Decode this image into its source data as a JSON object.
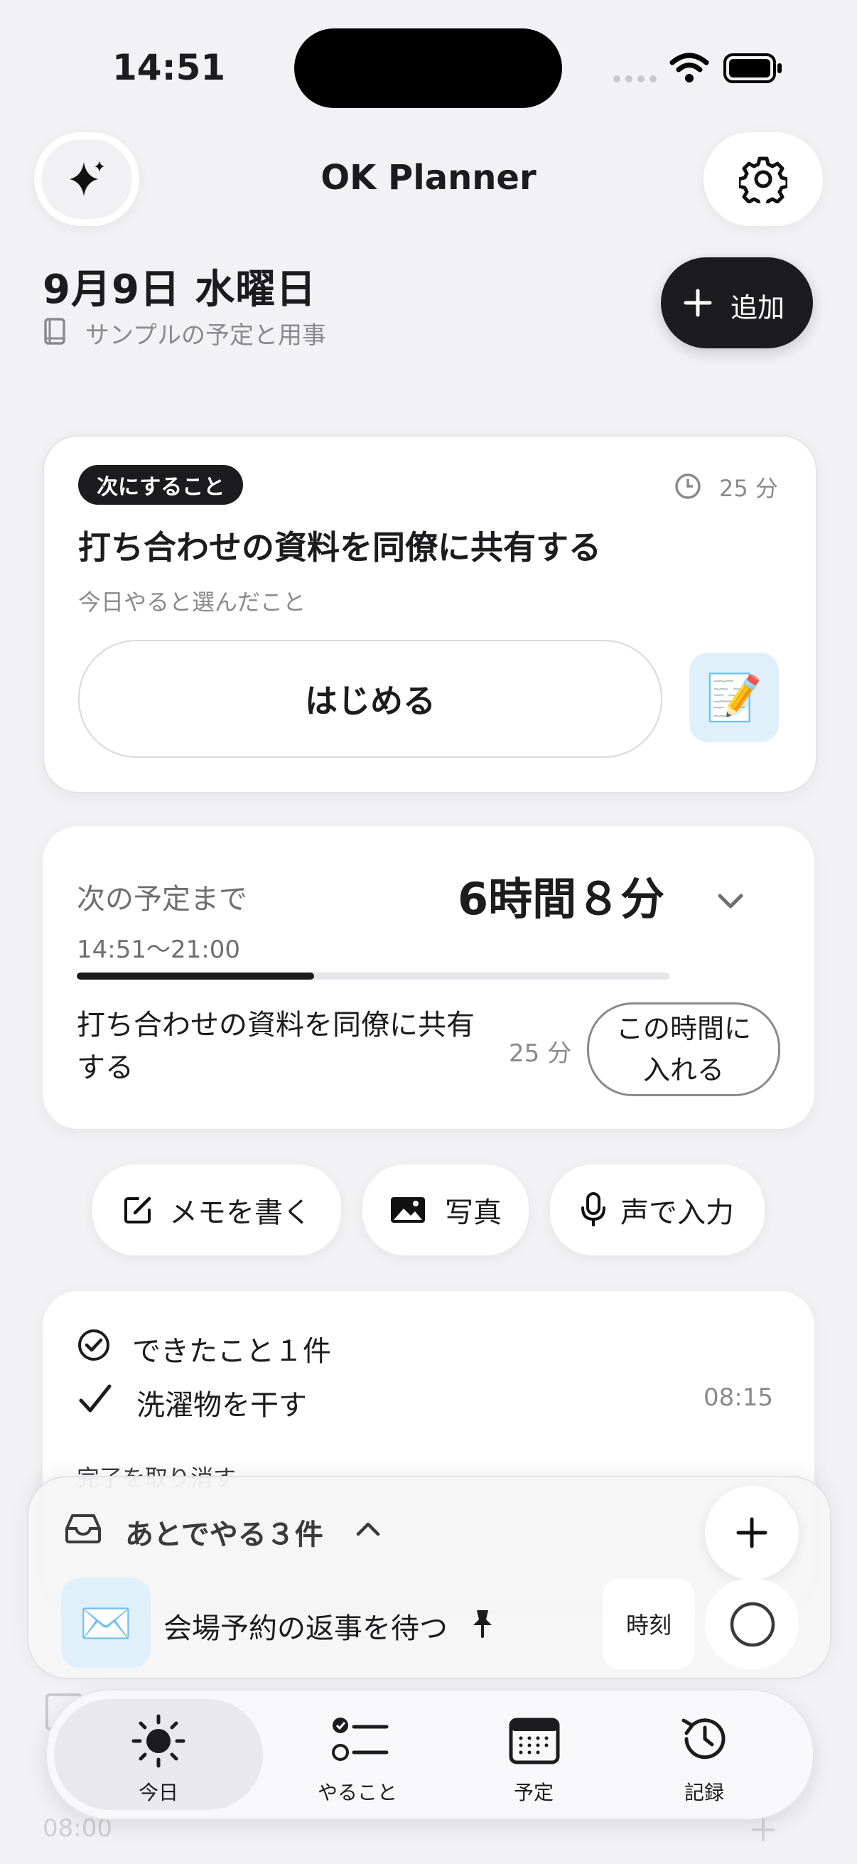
{
  "status_bar": {
    "time": "14:51"
  },
  "header": {
    "title": "OK Planner"
  },
  "date": {
    "label": "9月9日 水曜日",
    "subtitle": "サンプルの予定と用事"
  },
  "add_button": {
    "label": "追加"
  },
  "next_task": {
    "badge": "次にすること",
    "duration": "25 分",
    "title": "打ち合わせの資料を同僚に共有する",
    "subtitle": "今日やると選んだこと",
    "start_label": "はじめる",
    "emoji": "📝"
  },
  "next_event": {
    "label": "次の予定まで",
    "remaining": "6時間８分",
    "range": "14:51〜21:00",
    "progress": 0.4,
    "task": "打ち合わせの資料を同僚に共有する",
    "task_duration": "25 分",
    "insert_label": "この時間に入れる"
  },
  "quick_actions": [
    {
      "label": "メモを書く",
      "icon": "edit-icon"
    },
    {
      "label": "写真",
      "icon": "photo-icon"
    },
    {
      "label": "声で入力",
      "icon": "mic-icon"
    }
  ],
  "done": {
    "header": "できたこと１件",
    "items": [
      {
        "label": "洗濯物を干す",
        "time": "08:15"
      }
    ],
    "undo_label": "完了を取り消す"
  },
  "later": {
    "header": "あとでやる３件",
    "item": {
      "label": "会場予約の返事を待つ",
      "emoji": "✉️",
      "time_button": "時刻"
    }
  },
  "behind": {
    "time": "08:00"
  },
  "tabbar": [
    {
      "label": "今日",
      "icon": "sun-icon",
      "active": true
    },
    {
      "label": "やること",
      "icon": "checklist-icon",
      "active": false
    },
    {
      "label": "予定",
      "icon": "calendar-icon",
      "active": false
    },
    {
      "label": "記録",
      "icon": "history-icon",
      "active": false
    }
  ],
  "colors": {
    "accent": "#1c1c1e",
    "background": "#f2f2f4",
    "card": "#ffffff",
    "emoji_bg": "#dff0fb"
  }
}
